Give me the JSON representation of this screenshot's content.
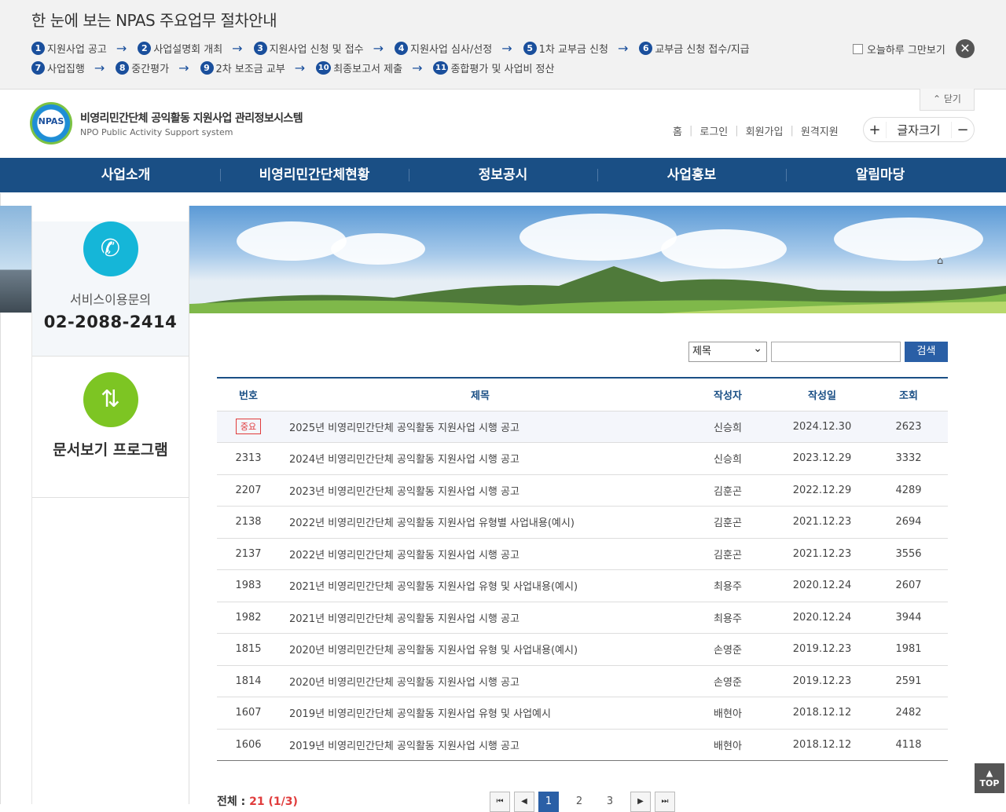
{
  "guide": {
    "title": "한 눈에 보는 NPAS 주요업무 절차안내",
    "steps_row1": [
      {
        "num": "1",
        "label": "지원사업 공고"
      },
      {
        "num": "2",
        "label": "사업설명회 개최"
      },
      {
        "num": "3",
        "label": "지원사업 신청 및 접수"
      },
      {
        "num": "4",
        "label": "지원사업 심사/선정"
      },
      {
        "num": "5",
        "label": "1차 교부금 신청"
      },
      {
        "num": "6",
        "label": "교부금 신청 접수/지급"
      }
    ],
    "steps_row2": [
      {
        "num": "7",
        "label": "사업집행"
      },
      {
        "num": "8",
        "label": "중간평가"
      },
      {
        "num": "9",
        "label": "2차 보조금 교부"
      },
      {
        "num": "10",
        "label": "최종보고서 제출"
      },
      {
        "num": "11",
        "label": "종합평가 및 사업비 정산"
      }
    ],
    "arrow": "→",
    "hide_today": "오늘하루 그만보기",
    "close_symbol": "✕"
  },
  "header": {
    "collapse_label": "닫기",
    "logo_mark": "NPAS",
    "logo_ko": "비영리민간단체 공익활동 지원사업 관리정보시스템",
    "logo_en": "NPO Public Activity Support system",
    "util_links": [
      "홈",
      "로그인",
      "회원가입",
      "원격지원"
    ],
    "fontsize_label": "글자크기",
    "fontsize_plus": "+",
    "fontsize_minus": "−"
  },
  "gnb": [
    "사업소개",
    "비영리민간단체현황",
    "정보공시",
    "사업홍보",
    "알림마당"
  ],
  "sidebar": {
    "service_label": "서비스이용문의",
    "service_phone": "02-2088-2414",
    "doc_label": "문서보기 프로그램"
  },
  "search": {
    "field_selected": "제목",
    "button_label": "검색",
    "input_value": ""
  },
  "board": {
    "columns": [
      "번호",
      "제목",
      "작성자",
      "작성일",
      "조회"
    ],
    "rows": [
      {
        "no": "중요",
        "title": "2025년 비영리민간단체 공익활동 지원사업 시행 공고",
        "author": "신승희",
        "date": "2024.12.30",
        "views": "2623",
        "notice": true
      },
      {
        "no": "2313",
        "title": "2024년 비영리민간단체 공익활동 지원사업 시행 공고",
        "author": "신승희",
        "date": "2023.12.29",
        "views": "3332"
      },
      {
        "no": "2207",
        "title": "2023년 비영리민간단체 공익활동 지원사업 시행 공고",
        "author": "김훈곤",
        "date": "2022.12.29",
        "views": "4289"
      },
      {
        "no": "2138",
        "title": "2022년 비영리민간단체 공익활동 지원사업 유형별 사업내용(예시)",
        "author": "김훈곤",
        "date": "2021.12.23",
        "views": "2694"
      },
      {
        "no": "2137",
        "title": "2022년 비영리민간단체 공익활동 지원사업 시행 공고",
        "author": "김훈곤",
        "date": "2021.12.23",
        "views": "3556"
      },
      {
        "no": "1983",
        "title": "2021년 비영리민간단체 공익활동 지원사업 유형 및 사업내용(예시)",
        "author": "최용주",
        "date": "2020.12.24",
        "views": "2607"
      },
      {
        "no": "1982",
        "title": "2021년 비영리민간단체 공익활동 지원사업 시행 공고",
        "author": "최용주",
        "date": "2020.12.24",
        "views": "3944"
      },
      {
        "no": "1815",
        "title": "2020년 비영리민간단체 공익활동 지원사업 유형 및 사업내용(예시)",
        "author": "손영준",
        "date": "2019.12.23",
        "views": "1981"
      },
      {
        "no": "1814",
        "title": "2020년 비영리민간단체 공익활동 지원사업 시행 공고",
        "author": "손영준",
        "date": "2019.12.23",
        "views": "2591"
      },
      {
        "no": "1607",
        "title": "2019년 비영리민간단체 공익활동 지원사업 유형 및 사업예시",
        "author": "배현아",
        "date": "2018.12.12",
        "views": "2482"
      },
      {
        "no": "1606",
        "title": "2019년 비영리민간단체 공익활동 지원사업 시행 공고",
        "author": "배현아",
        "date": "2018.12.12",
        "views": "4118"
      }
    ]
  },
  "footer": {
    "total_label": "전체 :",
    "total_count": "21",
    "page_info": "(1/3)",
    "pages": [
      "1",
      "2",
      "3"
    ],
    "current_page": "1",
    "top_label": "TOP"
  },
  "colors": {
    "primary": "#1a4f85",
    "button": "#2a5fa6",
    "badge": "#e03b3b"
  }
}
